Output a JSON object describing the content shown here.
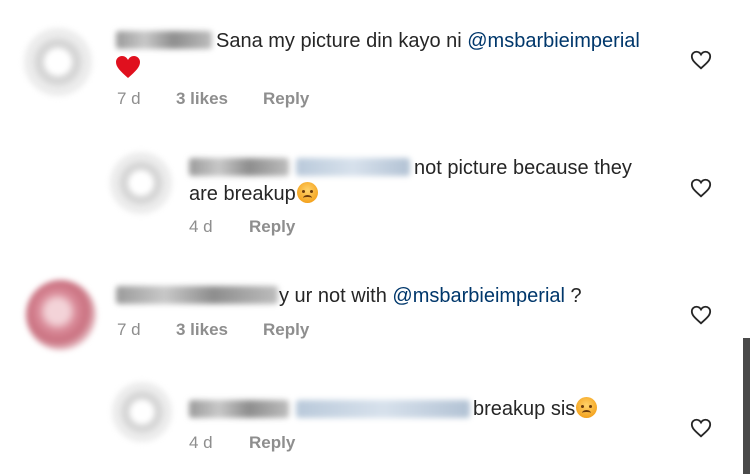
{
  "comments": [
    {
      "text": "Sana my picture din kayo ni ",
      "mention": "@msbarbieimperial",
      "time": "7 d",
      "likes": "3 likes",
      "reply": "Reply"
    },
    {
      "text_line1": "not picture because they",
      "text_line2": "are breakup",
      "time": "4 d",
      "reply": "Reply"
    },
    {
      "text": "y ur not with ",
      "mention": "@msbarbieimperial",
      "text_after": " ?",
      "time": "7 d",
      "likes": "3 likes",
      "reply": "Reply"
    },
    {
      "text": "breakup sis",
      "time": "4 d",
      "reply": "Reply"
    }
  ],
  "icons": {
    "like": "heart-outline-icon",
    "red_heart": "red-heart-emoji",
    "emoji": "crying-face-emoji"
  },
  "colors": {
    "mention": "#00376b",
    "meta": "#8e8e8e",
    "heart": "#e0101e"
  }
}
